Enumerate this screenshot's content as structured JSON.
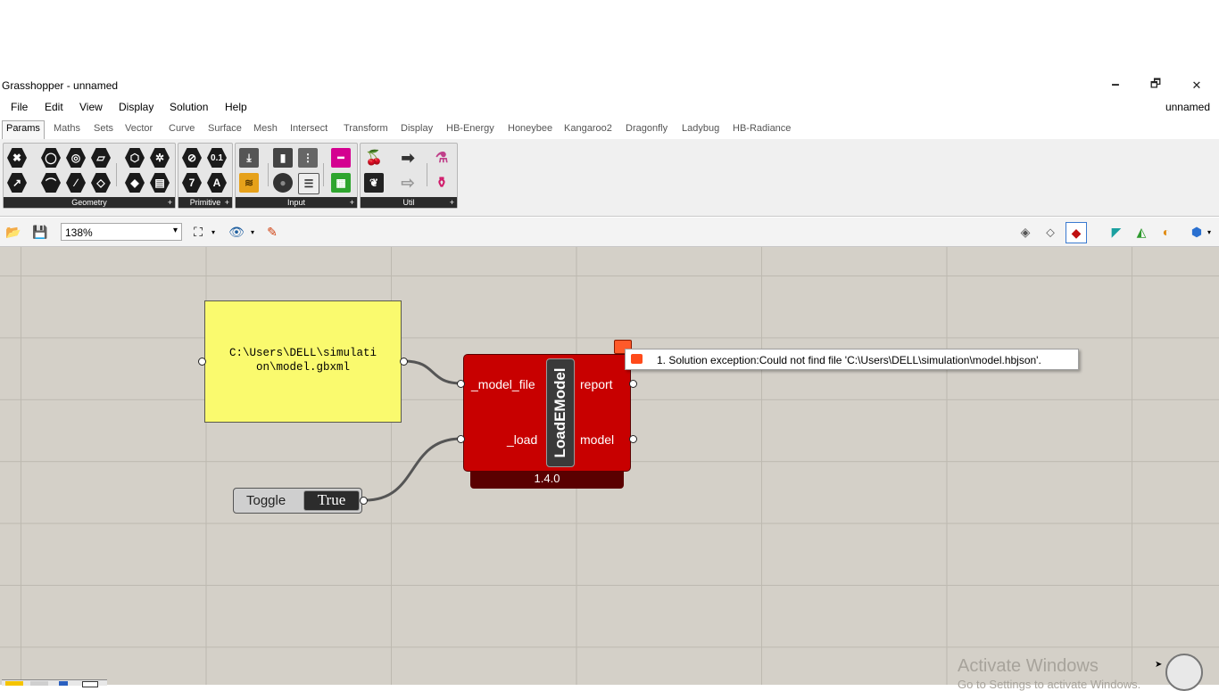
{
  "window": {
    "title": "Grasshopper - unnamed",
    "minimize_glyph": "🗕",
    "restore_glyph": "🗗",
    "close_glyph": "✕"
  },
  "menu": {
    "items": [
      "File",
      "Edit",
      "View",
      "Display",
      "Solution",
      "Help"
    ],
    "document_name": "unnamed"
  },
  "tabs": [
    "Params",
    "Maths",
    "Sets",
    "Vector",
    "Curve",
    "Surface",
    "Mesh",
    "Intersect",
    "Transform",
    "Display",
    "HB-Energy",
    "Honeybee",
    "Kangaroo2",
    "Dragonfly",
    "Ladybug",
    "HB-Radiance"
  ],
  "active_tab": "Params",
  "ribbon": {
    "panels": [
      {
        "label": "Geometry"
      },
      {
        "label": "Primitive"
      },
      {
        "label": "Input"
      },
      {
        "label": "Util"
      }
    ],
    "primitive_icons": {
      "number": "0.1",
      "integer": "7",
      "text": "A"
    }
  },
  "toolbar": {
    "zoom": "138%"
  },
  "canvas": {
    "panel_text": "C:\\Users\\DELL\\simulati\non\\model.gbxml",
    "component": {
      "name": "LoadEModel",
      "inputs": [
        "_model_file",
        "_load"
      ],
      "outputs": [
        "report",
        "model"
      ],
      "version": "1.4.0"
    },
    "error_message": "1. Solution exception:Could not find file 'C:\\Users\\DELL\\simulation\\model.hbjson'.",
    "toggle": {
      "label": "Toggle",
      "value": "True"
    }
  },
  "watermark": {
    "title": "Activate Windows",
    "subtitle": "Go to Settings to activate Windows."
  },
  "colors": {
    "canvas": "#d4d0c8",
    "component_error": "#c80000",
    "panel_yellow": "#fafa6e"
  }
}
